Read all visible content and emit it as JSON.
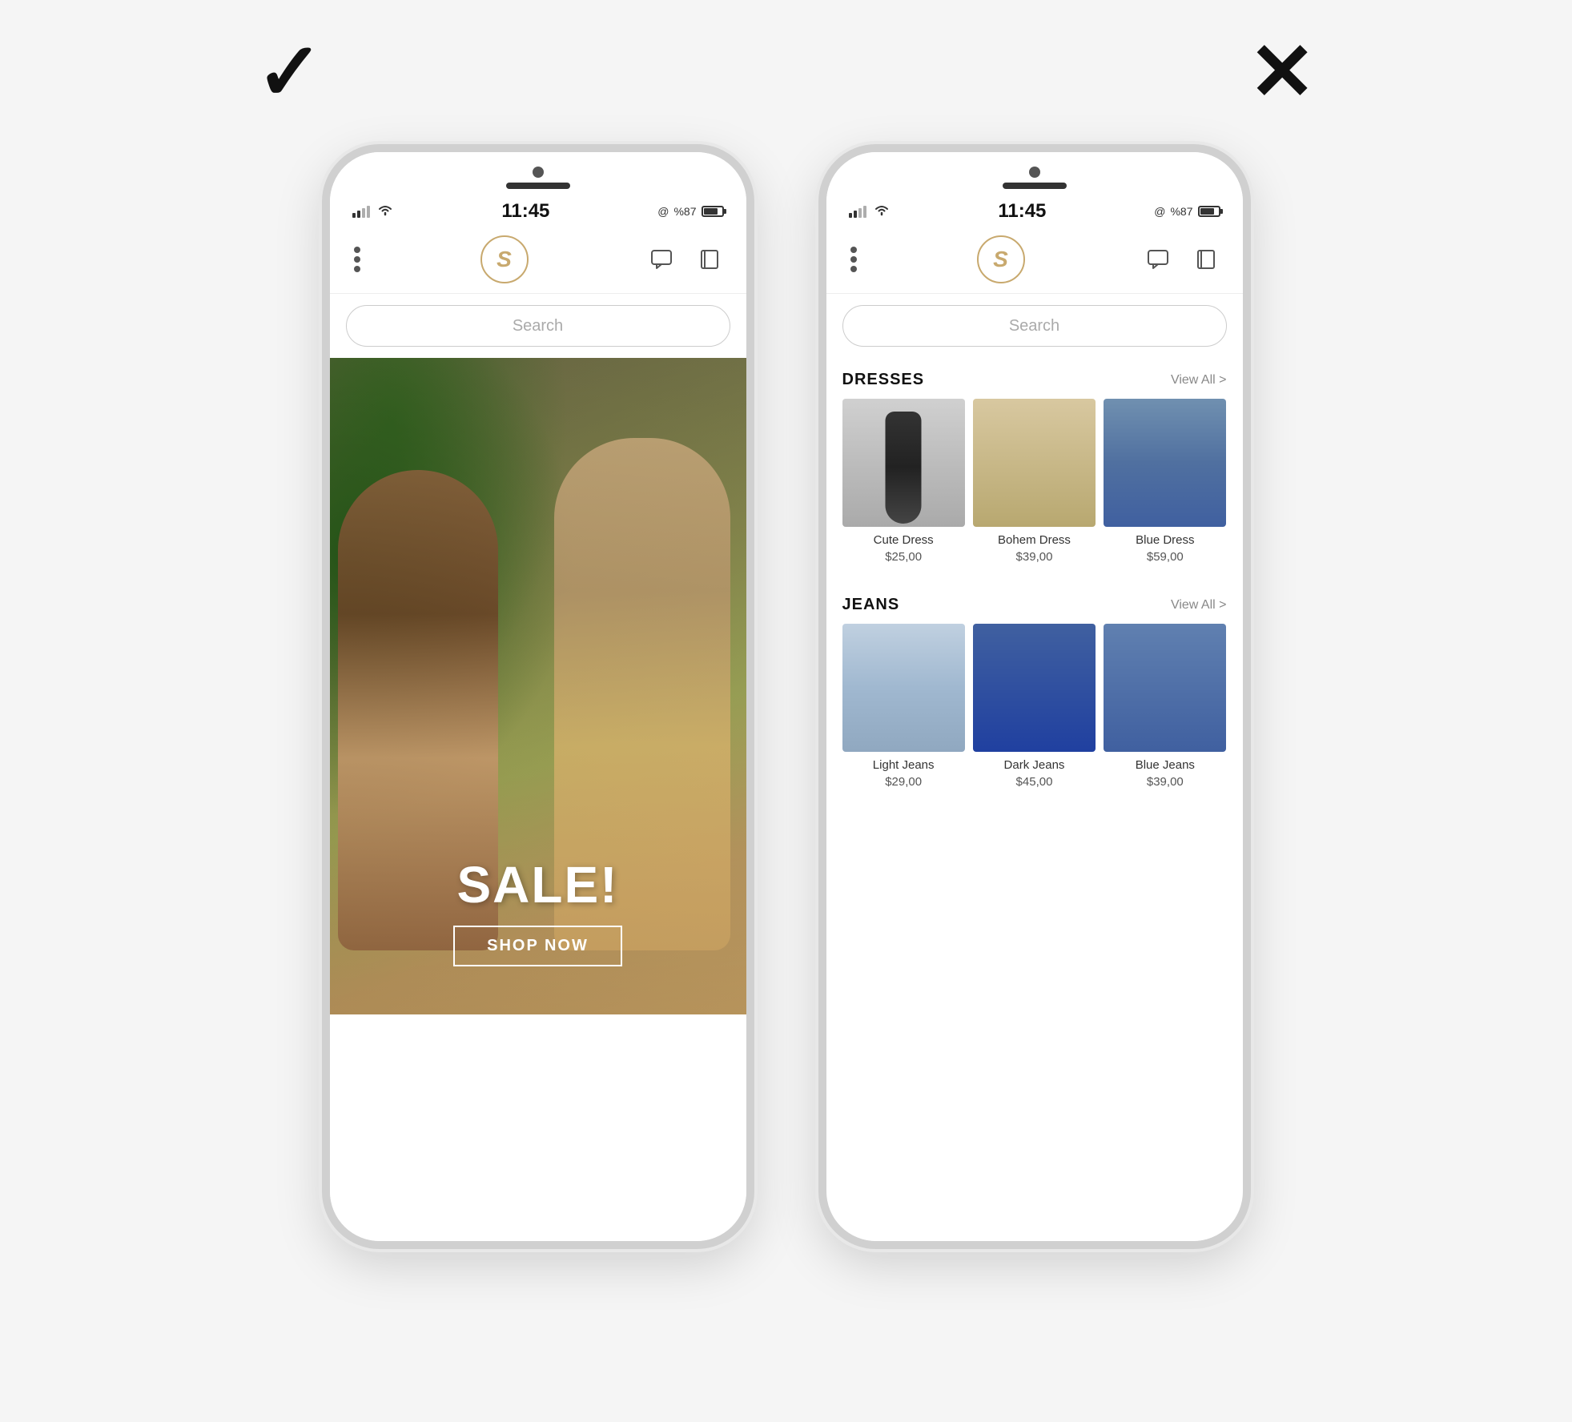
{
  "page": {
    "background_color": "#f5f5f5"
  },
  "left_panel": {
    "check_mark": "✓",
    "phone": {
      "status_bar": {
        "time": "11:45",
        "battery_percent": "%87",
        "at_symbol": "@"
      },
      "nav": {
        "logo_text": "S"
      },
      "search": {
        "placeholder": "Search"
      },
      "sale_banner": {
        "title": "SALE!",
        "button_label": "SHOP NOW"
      }
    }
  },
  "right_panel": {
    "x_mark": "✕",
    "phone": {
      "status_bar": {
        "time": "11:45",
        "battery_percent": "%87",
        "at_symbol": "@"
      },
      "nav": {
        "logo_text": "S"
      },
      "search": {
        "placeholder": "Search"
      },
      "sections": [
        {
          "id": "dresses",
          "title": "DRESSES",
          "view_all": "View All >",
          "products": [
            {
              "name": "Cute Dress",
              "price": "$25,00"
            },
            {
              "name": "Bohem Dress",
              "price": "$39,00"
            },
            {
              "name": "Blue Dress",
              "price": "$59,00"
            }
          ]
        },
        {
          "id": "jeans",
          "title": "JEANS",
          "view_all": "View All >",
          "products": [
            {
              "name": "Light Jeans",
              "price": "$29,00"
            },
            {
              "name": "Dark Jeans",
              "price": "$45,00"
            },
            {
              "name": "Blue Jeans",
              "price": "$39,00"
            }
          ]
        }
      ]
    }
  }
}
